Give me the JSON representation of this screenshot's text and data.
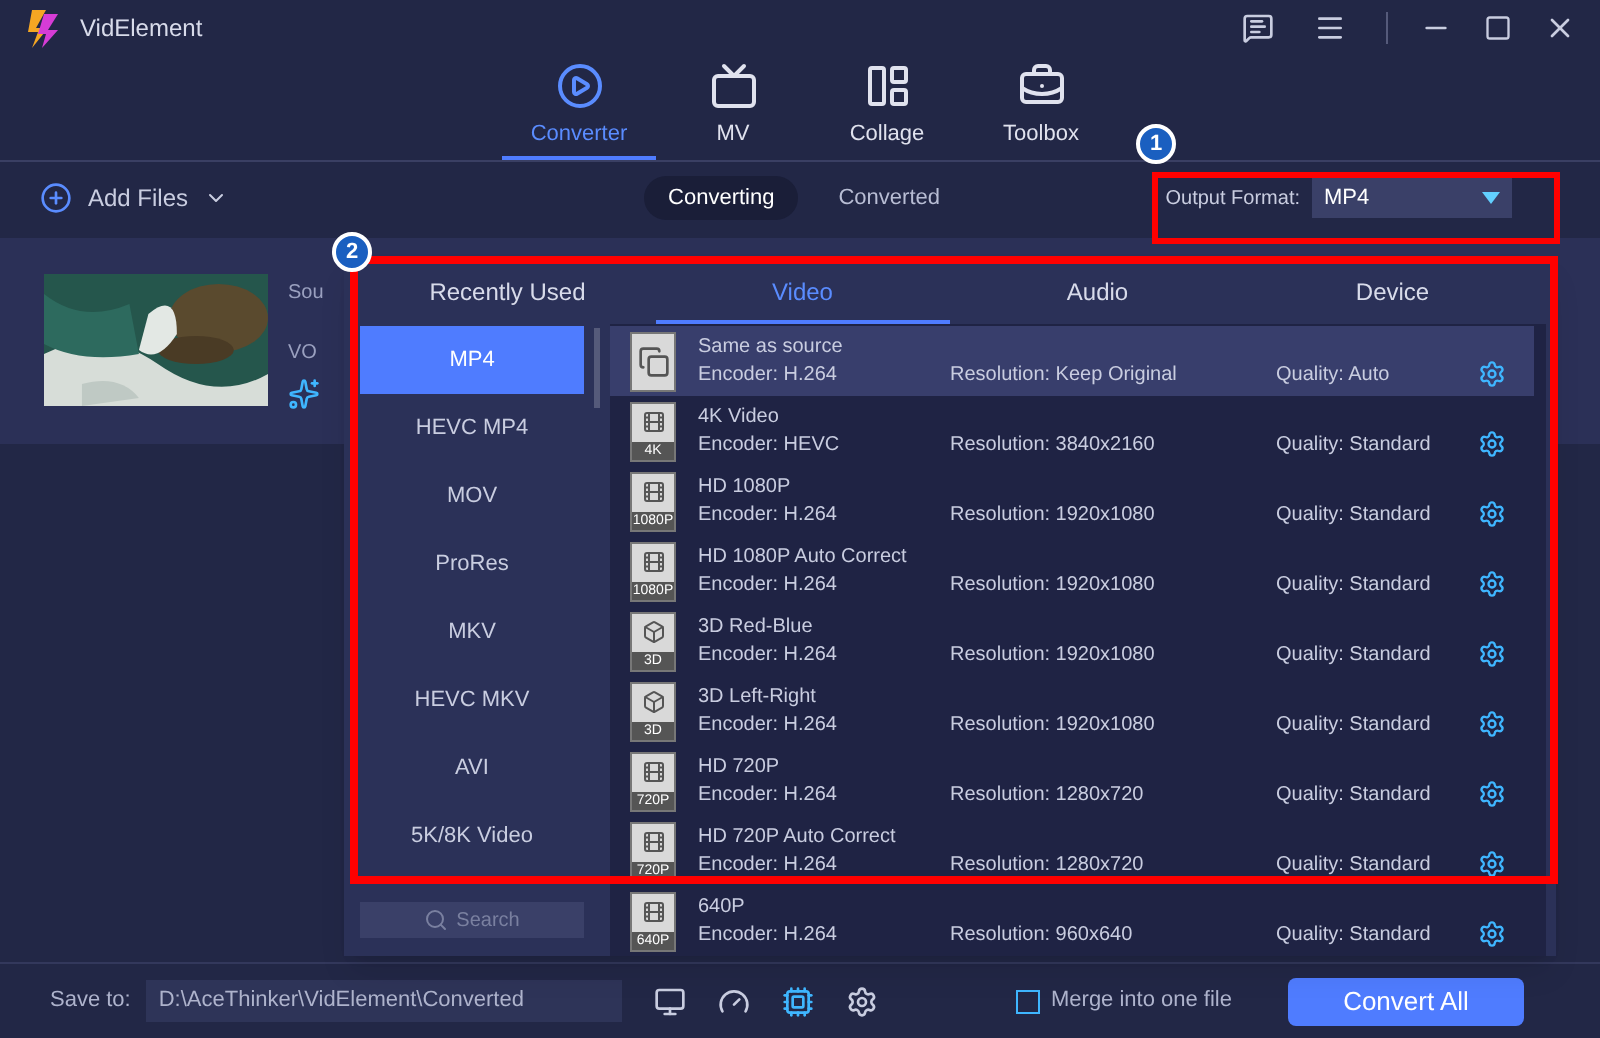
{
  "app": {
    "name": "VidElement"
  },
  "nav_tabs": [
    {
      "label": "Converter",
      "selected": true,
      "kind": "converter"
    },
    {
      "label": "MV",
      "selected": false,
      "kind": "mv"
    },
    {
      "label": "Collage",
      "selected": false,
      "kind": "collage"
    },
    {
      "label": "Toolbox",
      "selected": false,
      "kind": "toolbox"
    }
  ],
  "toolbar": {
    "add_files": "Add Files",
    "views": [
      {
        "label": "Converting",
        "selected": true
      },
      {
        "label": "Converted",
        "selected": false
      }
    ],
    "output_format": {
      "label": "Output Format:",
      "value": "MP4"
    }
  },
  "file_card": {
    "source": "Sou",
    "format": "VO"
  },
  "format_popup": {
    "tabs": [
      {
        "label": "Recently Used",
        "selected": false
      },
      {
        "label": "Video",
        "selected": true
      },
      {
        "label": "Audio",
        "selected": false
      },
      {
        "label": "Device",
        "selected": false
      }
    ],
    "categories": [
      {
        "label": "MP4",
        "selected": true
      },
      {
        "label": "HEVC MP4",
        "selected": false
      },
      {
        "label": "MOV",
        "selected": false
      },
      {
        "label": "ProRes",
        "selected": false
      },
      {
        "label": "MKV",
        "selected": false
      },
      {
        "label": "HEVC MKV",
        "selected": false
      },
      {
        "label": "AVI",
        "selected": false
      },
      {
        "label": "5K/8K Video",
        "selected": false
      }
    ],
    "search": {
      "placeholder": "Search"
    },
    "presets": [
      {
        "kind": "copy",
        "name": "Same as source",
        "encoder": "Encoder: H.264",
        "resolution": "Resolution: Keep Original",
        "quality": "Quality: Auto",
        "selected": true
      },
      {
        "kind": "film",
        "badge": "4K",
        "name": "4K Video",
        "encoder": "Encoder: HEVC",
        "resolution": "Resolution: 3840x2160",
        "quality": "Quality: Standard",
        "selected": false
      },
      {
        "kind": "film",
        "badge": "1080P",
        "name": "HD 1080P",
        "encoder": "Encoder: H.264",
        "resolution": "Resolution: 1920x1080",
        "quality": "Quality: Standard",
        "selected": false
      },
      {
        "kind": "film",
        "badge": "1080P",
        "name": "HD 1080P Auto Correct",
        "encoder": "Encoder: H.264",
        "resolution": "Resolution: 1920x1080",
        "quality": "Quality: Standard",
        "selected": false
      },
      {
        "kind": "cube",
        "badge": "3D",
        "name": "3D Red-Blue",
        "encoder": "Encoder: H.264",
        "resolution": "Resolution: 1920x1080",
        "quality": "Quality: Standard",
        "selected": false
      },
      {
        "kind": "cube",
        "badge": "3D",
        "name": "3D Left-Right",
        "encoder": "Encoder: H.264",
        "resolution": "Resolution: 1920x1080",
        "quality": "Quality: Standard",
        "selected": false
      },
      {
        "kind": "film",
        "badge": "720P",
        "name": "HD 720P",
        "encoder": "Encoder: H.264",
        "resolution": "Resolution: 1280x720",
        "quality": "Quality: Standard",
        "selected": false
      },
      {
        "kind": "film",
        "badge": "720P",
        "name": "HD 720P Auto Correct",
        "encoder": "Encoder: H.264",
        "resolution": "Resolution: 1280x720",
        "quality": "Quality: Standard",
        "selected": false
      },
      {
        "kind": "film",
        "badge": "640P",
        "name": "640P",
        "encoder": "Encoder: H.264",
        "resolution": "Resolution: 960x640",
        "quality": "Quality: Standard",
        "selected": false
      }
    ]
  },
  "save_bar": {
    "label": "Save to:",
    "path": "D:\\AceThinker\\VidElement\\Converted",
    "merge": {
      "label": "Merge into one file",
      "checked": false
    },
    "convert_button": "Convert All"
  },
  "annotations": [
    {
      "number": "1"
    },
    {
      "number": "2"
    }
  ]
}
